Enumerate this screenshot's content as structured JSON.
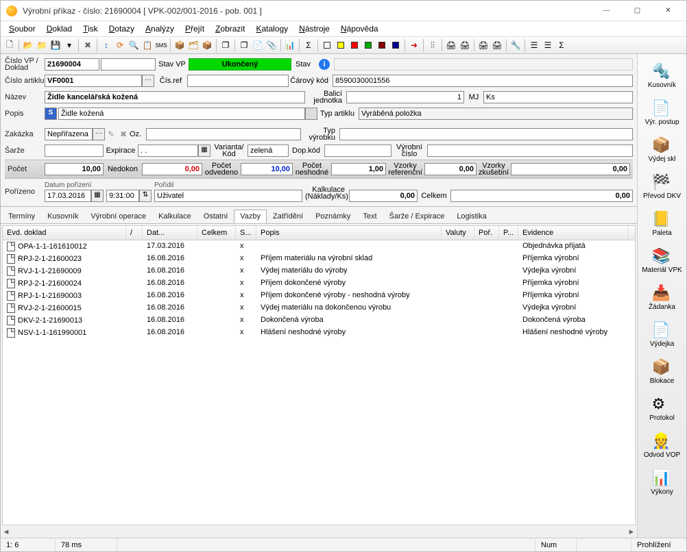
{
  "title": "Výrobní příkaz - číslo: 21690004  [ VPK-002/001-2016 - pob. 001 ]",
  "menu": [
    "Soubor",
    "Doklad",
    "Tisk",
    "Dotazy",
    "Analýzy",
    "Přejít",
    "Zobrazit",
    "Katalogy",
    "Nástroje",
    "Nápověda"
  ],
  "labels": {
    "cislo_vp": "Číslo VP / Doklad",
    "stav_vp": "Stav VP",
    "stav": "Stav",
    "cislo_artiklu": "Číslo artiklu",
    "cis_ref": "Čís.ref",
    "carovy_kod": "Čárový kód",
    "nazev": "Název",
    "balici": "Balicí jednotka",
    "mj": "MJ",
    "popis": "Popis",
    "typ_artiklu": "Typ artiklu",
    "zakazka": "Zakázka",
    "oz": "Oz.",
    "typ_vyrobku": "Typ výrobku",
    "sarze": "Šarže",
    "expirace": "Expirace",
    "varianta": "Varianta/ Kód",
    "dop_kod": "Dop.kód",
    "vyrobni_cislo": "Výrobní číslo",
    "pocet": "Počet",
    "nedokon": "Nedokon",
    "pocet_odvedeno": "Počet odvedeno",
    "pocet_neshodne": "Počet neshodné",
    "vzorky_ref": "Vzorky referenční",
    "vzorky_zk": "Vzorky zkušební",
    "porizeno": "Pořízeno",
    "datum_porizeni": "Datum pořízení",
    "poridil": "Pořídil",
    "kalkulace": "Kalkulace (Náklady/Ks)",
    "celkem": "Celkem"
  },
  "header": {
    "cislo_vp": "21690004",
    "stav_vp": "Ukončený",
    "cislo_artiklu": "VF0001",
    "cis_ref": "",
    "carovy_kod": "8590030001556",
    "nazev": "Židle kancelářská kožená",
    "balici_jednotka": "1",
    "mj": "Ks",
    "popis": "Židle kožená",
    "typ_artiklu": "Vyráběná položka",
    "zakazka": "Nepřiřazena",
    "oz": "",
    "typ_vyrobku": "",
    "sarze": "",
    "expirace": ".  .",
    "varianta": "zelená",
    "dop_kod": "",
    "vyrobni_cislo": "",
    "pocet": "10,00",
    "nedokon": "0,00",
    "pocet_odvedeno": "10,00",
    "pocet_neshodne": "1,00",
    "vzorky_ref": "0,00",
    "vzorky_zk": "0,00",
    "datum_porizeni": "17.03.2016",
    "cas": "9:31:00",
    "poridil": "Uživatel",
    "kalkulace": "0,00",
    "celkem": "0,00"
  },
  "tabs": [
    "Termíny",
    "Kusovník",
    "Výrobní operace",
    "Kalkulace",
    "Ostatní",
    "Vazby",
    "Zatřídění",
    "Poznámky",
    "Text",
    "Šarže / Expirace",
    "Logistika"
  ],
  "active_tab": "Vazby",
  "table": {
    "columns": [
      "Evd. doklad",
      "/",
      "Dat...",
      "Celkem",
      "S...",
      "Popis",
      "Valuty",
      "Poř.",
      "P...",
      "Evidence"
    ],
    "rows": [
      {
        "doklad": "OPA-1-1-161610012",
        "slash": "",
        "dat": "17.03.2016",
        "celkem": "",
        "s": "x",
        "popis": "",
        "valuty": "",
        "por": "",
        "p": "",
        "evidence": "Objednávka přijatá"
      },
      {
        "doklad": "RPJ-2-1-21600023",
        "slash": "",
        "dat": "16.08.2016",
        "celkem": "",
        "s": "x",
        "popis": "Příjem materiálu na výrobní sklad",
        "valuty": "",
        "por": "",
        "p": "",
        "evidence": "Příjemka výrobní"
      },
      {
        "doklad": "RVJ-1-1-21690009",
        "slash": "",
        "dat": "16.08.2016",
        "celkem": "",
        "s": "x",
        "popis": "Výdej materiálu do výroby",
        "valuty": "",
        "por": "",
        "p": "",
        "evidence": "Výdejka výrobní"
      },
      {
        "doklad": "RPJ-2-1-21600024",
        "slash": "",
        "dat": "16.08.2016",
        "celkem": "",
        "s": "x",
        "popis": "Příjem dokončené výroby",
        "valuty": "",
        "por": "",
        "p": "",
        "evidence": "Příjemka výrobní"
      },
      {
        "doklad": "RPJ-1-1-21690003",
        "slash": "",
        "dat": "16.08.2016",
        "celkem": "",
        "s": "x",
        "popis": "Příjem dokončené výroby - neshodná výroby",
        "valuty": "",
        "por": "",
        "p": "",
        "evidence": "Příjemka výrobní"
      },
      {
        "doklad": "RVJ-2-1-21600015",
        "slash": "",
        "dat": "16.08.2016",
        "celkem": "",
        "s": "x",
        "popis": "Výdej materiálu na dokončenou výrobu",
        "valuty": "",
        "por": "",
        "p": "",
        "evidence": "Výdejka výrobní"
      },
      {
        "doklad": "DKV-2-1-21690013",
        "slash": "",
        "dat": "16.08.2016",
        "celkem": "",
        "s": "x",
        "popis": "Dokončená výroba",
        "valuty": "",
        "por": "",
        "p": "",
        "evidence": "Dokončená výroba"
      },
      {
        "doklad": "NSV-1-1-161990001",
        "slash": "",
        "dat": "16.08.2016",
        "celkem": "",
        "s": "x",
        "popis": "Hlášení neshodné výroby",
        "valuty": "",
        "por": "",
        "p": "",
        "evidence": "Hlášení neshodné výroby"
      }
    ]
  },
  "sidebar": [
    {
      "id": "kusovnik",
      "label": "Kusovník"
    },
    {
      "id": "vyr-postup",
      "label": "Výr. postup"
    },
    {
      "id": "vydej-skl",
      "label": "Výdej skl"
    },
    {
      "id": "prevod-dkv",
      "label": "Převod DKV"
    },
    {
      "id": "paleta",
      "label": "Paleta"
    },
    {
      "id": "material-vpk",
      "label": "Materiál VPK"
    },
    {
      "id": "zadanka",
      "label": "Žádanka"
    },
    {
      "id": "vydejka",
      "label": "Výdejka"
    },
    {
      "id": "blokace",
      "label": "Blokace"
    },
    {
      "id": "protokol",
      "label": "Protokol"
    },
    {
      "id": "odvod-vop",
      "label": "Odvod VOP"
    },
    {
      "id": "vykony",
      "label": "Výkony"
    }
  ],
  "status": {
    "pos": "1:   6",
    "time": "78 ms",
    "num": "Num",
    "mode": "Prohlížení"
  }
}
